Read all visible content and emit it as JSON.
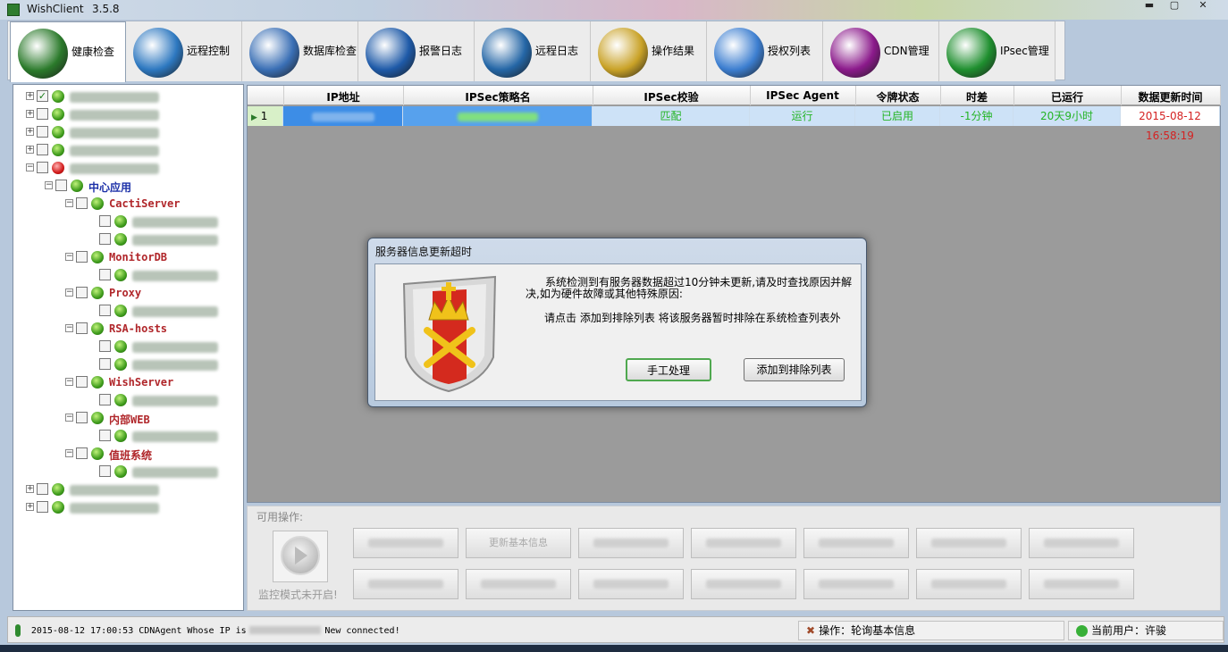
{
  "window": {
    "title": "WishClient",
    "version": "3.5.8",
    "min": "▬",
    "max": "▢",
    "close": "✕"
  },
  "toolbar": [
    {
      "label": "健康检查",
      "icon": "radar-icon",
      "color": "#2b7a2b"
    },
    {
      "label": "远程控制",
      "icon": "globe-icon",
      "color": "#2d78c0"
    },
    {
      "label": "数据库检查",
      "icon": "database-globe-icon",
      "color": "#3a6fb5"
    },
    {
      "label": "报警日志",
      "icon": "megaphone-icon",
      "color": "#1e5aa8"
    },
    {
      "label": "远程日志",
      "icon": "wrench-globe-icon",
      "color": "#2466a6"
    },
    {
      "label": "操作结果",
      "icon": "tools-icon",
      "color": "#c9a227"
    },
    {
      "label": "授权列表",
      "icon": "cube-check-icon",
      "color": "#3c7ed0"
    },
    {
      "label": "CDN管理",
      "icon": "yinyang-purple-icon",
      "color": "#8b1a8b"
    },
    {
      "label": "IPsec管理",
      "icon": "yinyang-green-icon",
      "color": "#1f8f2f"
    }
  ],
  "tree": [
    {
      "label": "Blurred",
      "blur": true,
      "lvl": 0,
      "checked": true,
      "status": "green"
    },
    {
      "label": "Blurred",
      "blur": true,
      "lvl": 0,
      "status": "green"
    },
    {
      "label": "Blurred",
      "blur": true,
      "lvl": 0,
      "status": "green"
    },
    {
      "label": "Blurred",
      "blur": true,
      "lvl": 0,
      "status": "green"
    },
    {
      "label": "Blurred",
      "blur": true,
      "lvl": 0,
      "status": "red"
    },
    {
      "label": "中心应用",
      "lvl": 1,
      "style": "center",
      "status": "green"
    },
    {
      "label": "CactiServer",
      "lvl": 2,
      "style": "grp",
      "status": "green"
    },
    {
      "label": "Blurred",
      "blur": true,
      "lvl": 3,
      "status": "green"
    },
    {
      "label": "Blurred",
      "blur": true,
      "lvl": 3,
      "status": "green"
    },
    {
      "label": "MonitorDB",
      "lvl": 2,
      "style": "grp",
      "status": "green"
    },
    {
      "label": "Blurred",
      "blur": true,
      "lvl": 3,
      "status": "green"
    },
    {
      "label": "Proxy",
      "lvl": 2,
      "style": "grp",
      "status": "green"
    },
    {
      "label": "Blurred",
      "blur": true,
      "lvl": 3,
      "status": "green"
    },
    {
      "label": "RSA-hosts",
      "lvl": 2,
      "style": "grp",
      "status": "green"
    },
    {
      "label": "Blurred",
      "blur": true,
      "lvl": 3,
      "status": "green"
    },
    {
      "label": "Blurred",
      "blur": true,
      "lvl": 3,
      "status": "green"
    },
    {
      "label": "WishServer",
      "lvl": 2,
      "style": "grp",
      "status": "green"
    },
    {
      "label": "Blurred",
      "blur": true,
      "lvl": 3,
      "status": "green"
    },
    {
      "label": "内部WEB",
      "lvl": 2,
      "style": "grp",
      "status": "green"
    },
    {
      "label": "Blurred",
      "blur": true,
      "lvl": 3,
      "status": "green"
    },
    {
      "label": "值班系统",
      "lvl": 2,
      "style": "grp",
      "status": "green"
    },
    {
      "label": "Blurred",
      "blur": true,
      "lvl": 3,
      "status": "green"
    },
    {
      "label": "Blurred",
      "blur": true,
      "lvl": 0,
      "status": "green"
    },
    {
      "label": "Blurred",
      "blur": true,
      "lvl": 0,
      "status": "green"
    }
  ],
  "grid": {
    "columns": [
      "IP地址",
      "IPSec策略名",
      "IPSec校验",
      "IPSec Agent",
      "令牌状态",
      "时差",
      "已运行",
      "数据更新时间"
    ],
    "row": {
      "index": "1",
      "ip": "",
      "policy": "",
      "check": "匹配",
      "agent": "运行",
      "token": "已启用",
      "timediff": "-1分钟",
      "uptime": "20天9小时",
      "updated": "2015-08-12 16:58:19"
    }
  },
  "ops": {
    "title": "可用操作:",
    "monitor_label": "监控模式未开启!",
    "visible_button": "更新基本信息"
  },
  "status": {
    "log": "2015-08-12 17:00:53  CDNAgent Whose IP is",
    "log_tail": "New connected!",
    "operation": "操作：轮询基本信息",
    "user": "当前用户：许骏"
  },
  "dialog": {
    "title": "服务器信息更新超时",
    "message1": "系统检测到有服务器数据超过10分钟未更新,请及时查找原因并解决,如为硬件故障或其他特殊原因:",
    "message2": "请点击  添加到排除列表  将该服务器暂时排除在系统检查列表外",
    "manual_btn": "手工处理",
    "add_btn": "添加到排除列表"
  }
}
